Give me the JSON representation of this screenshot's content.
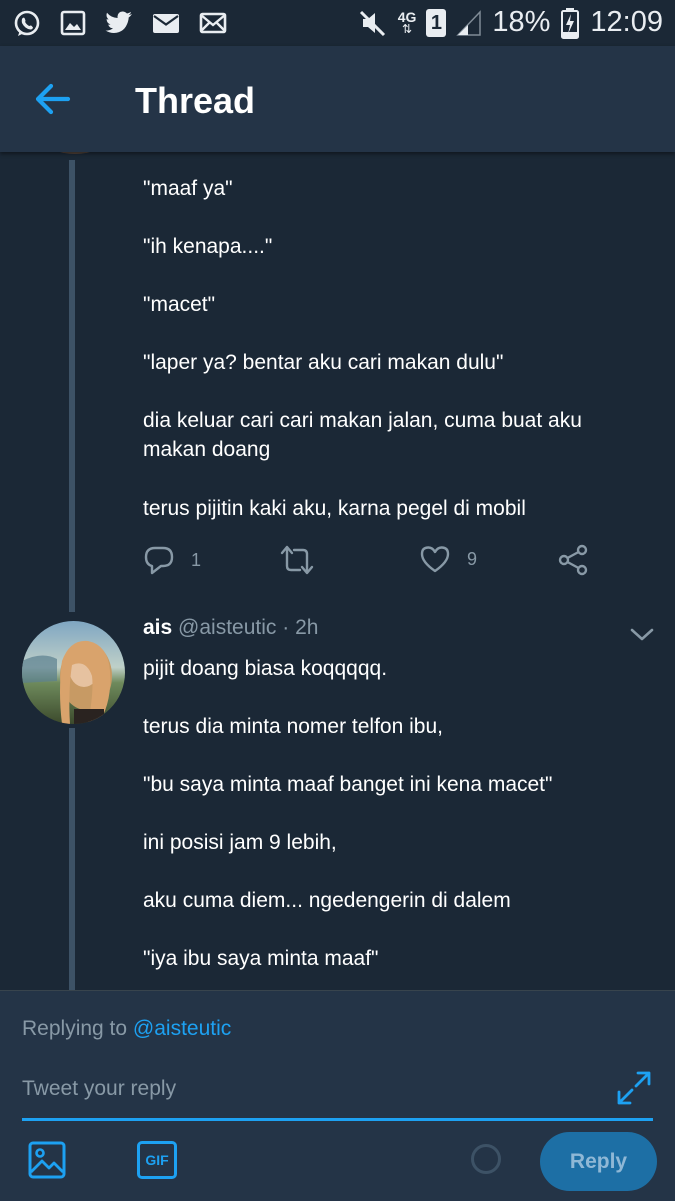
{
  "status_bar": {
    "network": "4G",
    "sim": "1",
    "battery": "18%",
    "time": "12:09",
    "left_icons": [
      "whatsapp-icon",
      "gallery-icon",
      "twitter-icon",
      "email-icon",
      "mail-icon"
    ]
  },
  "header": {
    "title": "Thread"
  },
  "tweet1": {
    "paragraphs": [
      "\"maaf ya\"",
      "\"ih kenapa....\"",
      "\"macet\"",
      "\"laper ya? bentar aku cari makan dulu\"",
      "dia keluar cari cari makan jalan, cuma buat aku makan doang",
      "terus pijitin kaki aku, karna pegel di mobil"
    ],
    "reply_count": "1",
    "like_count": "9"
  },
  "tweet2": {
    "name": "ais",
    "handle": "@aisteutic",
    "time": "· 2h",
    "paragraphs": [
      "pijit doang biasa koqqqqq.",
      "terus dia minta nomer telfon ibu,",
      "\"bu saya minta maaf banget ini kena macet\"",
      "ini posisi jam 9 lebih,",
      "aku cuma diem... ngedengerin di dalem",
      "\"iya ibu saya minta maaf\""
    ]
  },
  "reply_box": {
    "replying_prefix": "Replying to",
    "replying_handle": "@aisteutic",
    "placeholder": "Tweet your reply",
    "gif_label": "GIF",
    "reply_button": "Reply"
  },
  "colors": {
    "background": "#1b2836",
    "appbar": "#243447",
    "accent": "#1da1f2",
    "muted": "#8899a6"
  }
}
